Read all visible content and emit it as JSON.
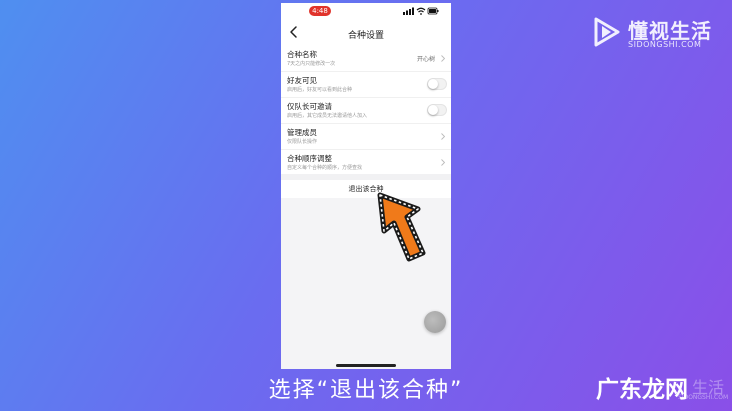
{
  "watermark": {
    "brand_cn": "懂视生活",
    "brand_en": "SIDONGSHI.COM",
    "bottom_cn": "广东龙网",
    "bottom_ghost": "生活",
    "bottom_en": "SIDONGSHI.COM"
  },
  "status_bar": {
    "time": "4:48"
  },
  "nav": {
    "title": "合种设置"
  },
  "settings": [
    {
      "title": "合种名称",
      "subtitle": "7天之内只能修改一次",
      "value": "开心树",
      "control": "chevron"
    },
    {
      "title": "好友可见",
      "subtitle": "启用后，好友可以看到此合种",
      "control": "toggle",
      "on": false
    },
    {
      "title": "仅队长可邀请",
      "subtitle": "启用后，其它成员无法邀请他人加入",
      "control": "toggle",
      "on": false
    },
    {
      "title": "管理成员",
      "subtitle": "仅限队长操作",
      "control": "chevron"
    },
    {
      "title": "合种顺序调整",
      "subtitle": "自定义每个合种的顺序，方便查找",
      "control": "chevron"
    }
  ],
  "exit_button": "退出该合种",
  "caption": "选择“退出该合种”",
  "colors": {
    "accent_red": "#e0332b",
    "arrow_orange": "#f07a1a"
  }
}
